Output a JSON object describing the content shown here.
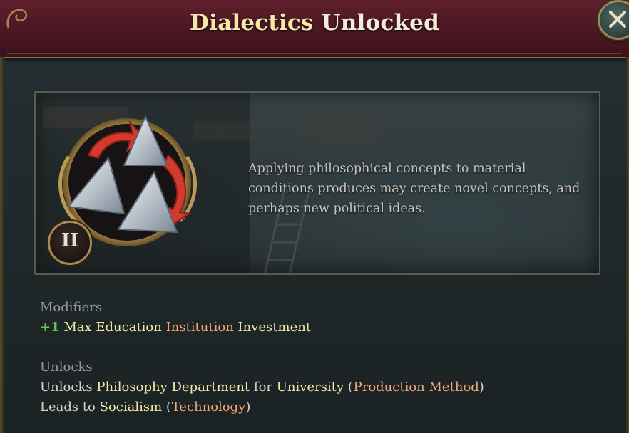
{
  "title": {
    "highlight": "Dialectics",
    "rest": " Unlocked"
  },
  "close_icon": "close-x-icon",
  "card": {
    "icon": "dialectics-triangles-icon",
    "tier": "II",
    "description": "Applying philosophical concepts to material conditions produces may create novel concepts, and perhaps new political ideas."
  },
  "modifiers": {
    "label": "Modifiers",
    "value": "+1",
    "part1": "Max Education",
    "part2": "Institution",
    "part3": "Investment"
  },
  "unlocks": {
    "label": "Unlocks",
    "line1": {
      "prefix": "Unlocks",
      "item": "Philosophy Department",
      "mid": "for",
      "target": "University",
      "open": "(",
      "type": "Production Method",
      "close": ")"
    },
    "line2": {
      "prefix": "Leads to",
      "item": "Socialism",
      "open": "(",
      "type": "Technology",
      "close": ")"
    }
  },
  "colors": {
    "header": "#4a1722",
    "gold_text": "#f5e9a6",
    "orange_text": "#f2a777",
    "green_text": "#6bc24a",
    "body_bg": "#1f2628"
  }
}
